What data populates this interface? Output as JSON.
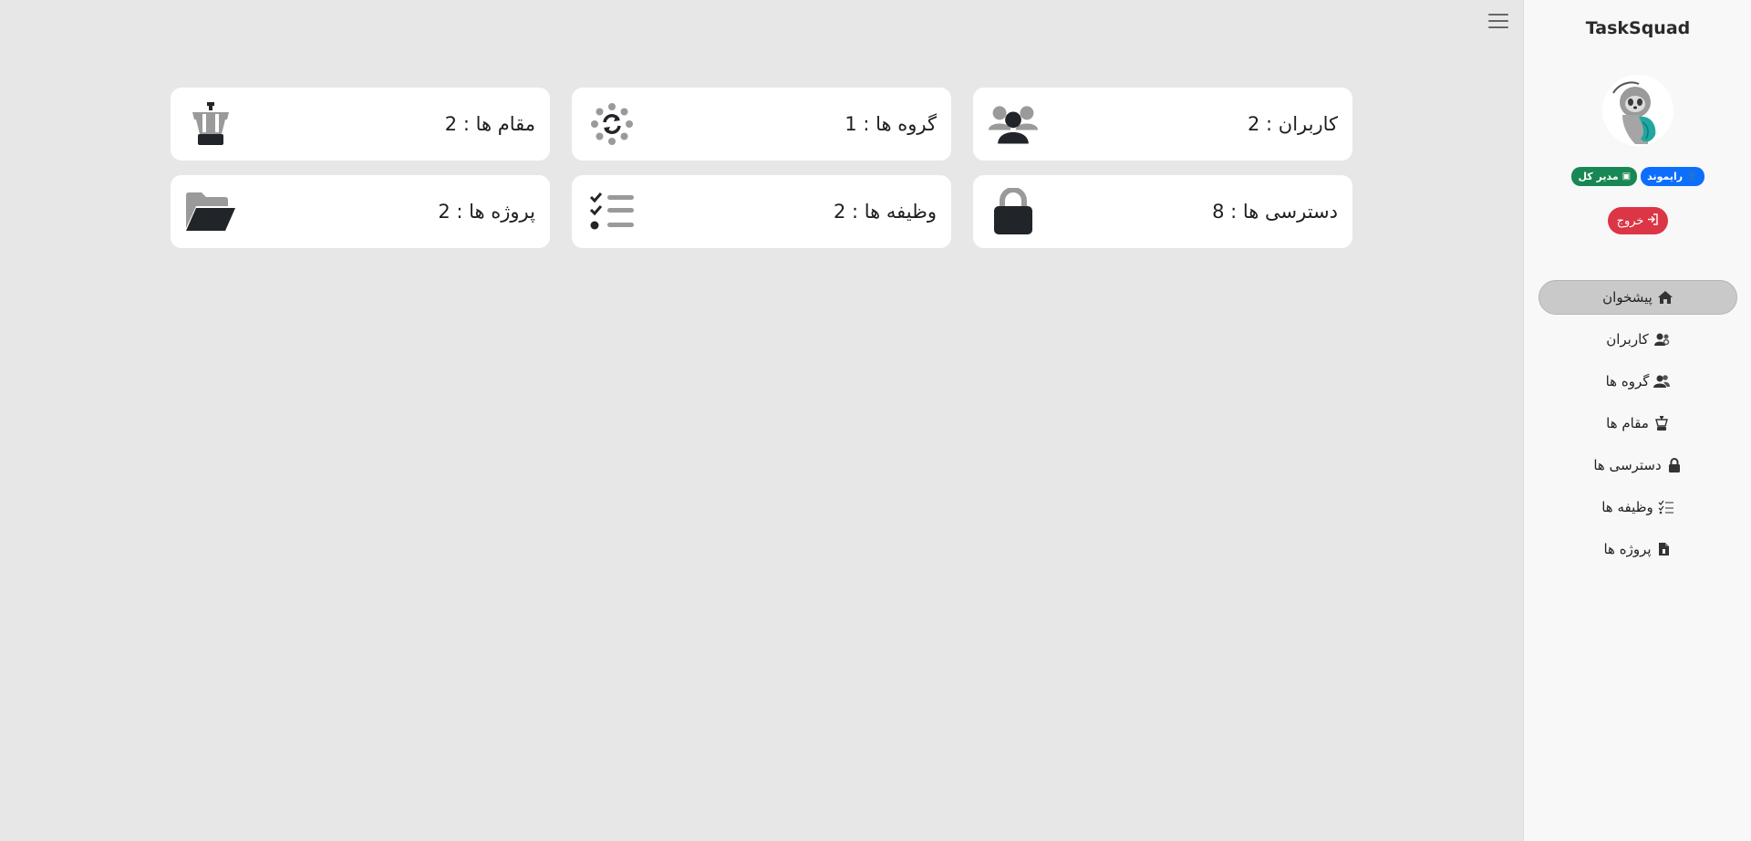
{
  "brand": "TaskSquad",
  "user": {
    "name": "رایموند",
    "role": "مدیر کل",
    "role_color": "#198754",
    "name_color": "#0d6efd"
  },
  "logout_label": "خروج",
  "logout_color": "#dc3545",
  "nav": [
    {
      "label": "پیشخوان",
      "icon": "home-icon",
      "active": true
    },
    {
      "label": "کاربران",
      "icon": "users-gear-icon",
      "active": false
    },
    {
      "label": "گروه ها",
      "icon": "user-group-icon",
      "active": false
    },
    {
      "label": "مقام ها",
      "icon": "chess-rook-icon",
      "active": false
    },
    {
      "label": "دسترسی ها",
      "icon": "lock-icon",
      "active": false
    },
    {
      "label": "وظیفه ها",
      "icon": "list-check-icon",
      "active": false
    },
    {
      "label": "پروژه ها",
      "icon": "file-icon",
      "active": false
    }
  ],
  "stats": [
    {
      "label": "کاربران : 2",
      "icon": "users-icon"
    },
    {
      "label": "گروه ها : 1",
      "icon": "group-sync-icon"
    },
    {
      "label": "مقام ها : 2",
      "icon": "chess-rook-icon"
    },
    {
      "label": "دسترسی ها : 8",
      "icon": "lock-icon"
    },
    {
      "label": "وظیفه ها : 2",
      "icon": "list-check-icon"
    },
    {
      "label": "پروژه ها : 2",
      "icon": "folder-open-icon"
    }
  ]
}
